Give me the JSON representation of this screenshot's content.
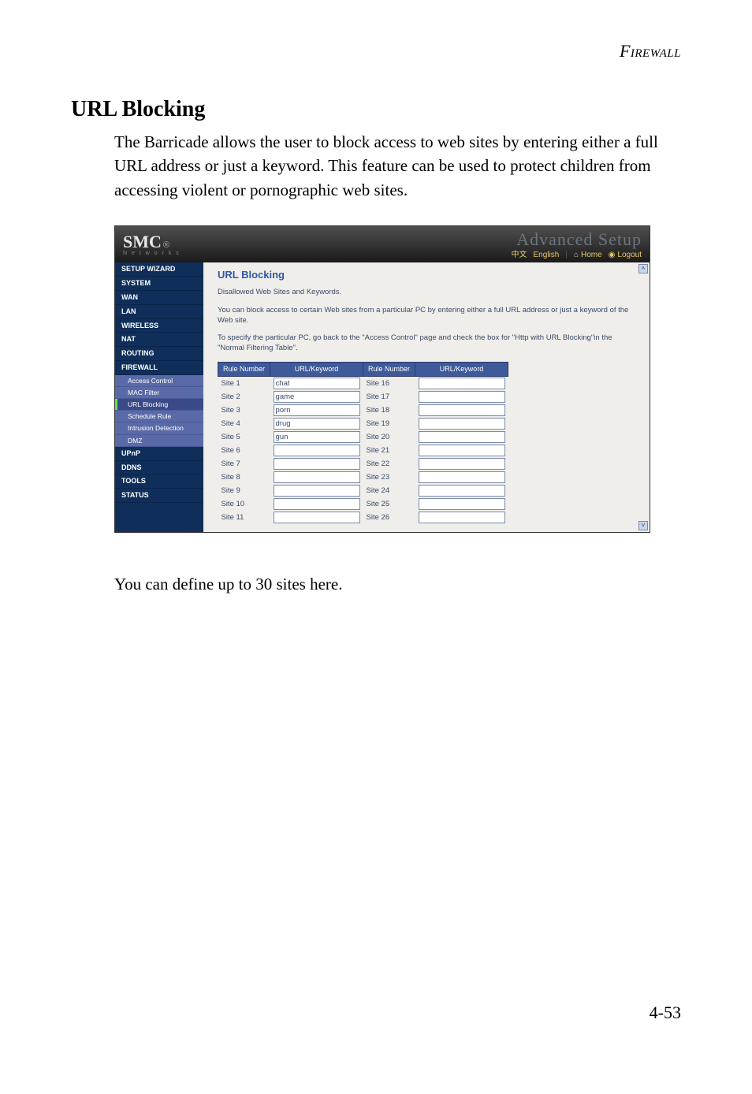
{
  "doc": {
    "running_head": "Firewall",
    "section_title": "URL Blocking",
    "intro": "The Barricade allows the user to block access to web sites by entering either a full URL address or just a keyword. This feature can be used to protect children from accessing violent or pornographic web sites.",
    "after_text": "You can define up to 30 sites here.",
    "page_num": "4-53"
  },
  "router": {
    "brand_main": "SMC",
    "brand_reg": "®",
    "brand_sub": "N e t w o r k s",
    "adv_setup": "Advanced Setup",
    "lang_cn": "中文",
    "lang_en": "English",
    "home": "Home",
    "logout": "Logout",
    "sidebar": {
      "items": [
        {
          "label": "SETUP WIZARD",
          "type": "top"
        },
        {
          "label": "SYSTEM",
          "type": "top"
        },
        {
          "label": "WAN",
          "type": "top"
        },
        {
          "label": "LAN",
          "type": "top"
        },
        {
          "label": "WIRELESS",
          "type": "top"
        },
        {
          "label": "NAT",
          "type": "top"
        },
        {
          "label": "ROUTING",
          "type": "top"
        },
        {
          "label": "FIREWALL",
          "type": "top"
        },
        {
          "label": "Access Control",
          "type": "sub"
        },
        {
          "label": "MAC Filter",
          "type": "sub"
        },
        {
          "label": "URL Blocking",
          "type": "sub",
          "active": true
        },
        {
          "label": "Schedule Rule",
          "type": "sub"
        },
        {
          "label": "Intrusion Detection",
          "type": "sub"
        },
        {
          "label": "DMZ",
          "type": "sub"
        },
        {
          "label": "UPnP",
          "type": "top"
        },
        {
          "label": "DDNS",
          "type": "top"
        },
        {
          "label": "TOOLS",
          "type": "top"
        },
        {
          "label": "STATUS",
          "type": "top"
        }
      ]
    },
    "content": {
      "title": "URL Blocking",
      "p1": "Disallowed Web Sites and Keywords.",
      "p2": "You can block access to certain Web sites from a particular PC by entering either a full URL address or just a keyword of the Web site.",
      "p3": "To specify the particular PC, go back to the \"Access Control\" page and check the box for \"Http with URL Blocking\"in the \"Normal Filtering Table\".",
      "headers": {
        "rule": "Rule Number",
        "url": "URL/Keyword"
      },
      "rows_left": [
        {
          "rn": "Site 1",
          "val": "chat"
        },
        {
          "rn": "Site 2",
          "val": "game"
        },
        {
          "rn": "Site 3",
          "val": "porn"
        },
        {
          "rn": "Site 4",
          "val": "drug"
        },
        {
          "rn": "Site 5",
          "val": "gun"
        },
        {
          "rn": "Site 6",
          "val": ""
        },
        {
          "rn": "Site 7",
          "val": ""
        },
        {
          "rn": "Site 8",
          "val": ""
        },
        {
          "rn": "Site 9",
          "val": ""
        },
        {
          "rn": "Site 10",
          "val": ""
        },
        {
          "rn": "Site 11",
          "val": ""
        }
      ],
      "rows_right": [
        {
          "rn": "Site 16",
          "val": ""
        },
        {
          "rn": "Site 17",
          "val": ""
        },
        {
          "rn": "Site 18",
          "val": ""
        },
        {
          "rn": "Site 19",
          "val": ""
        },
        {
          "rn": "Site 20",
          "val": ""
        },
        {
          "rn": "Site 21",
          "val": ""
        },
        {
          "rn": "Site 22",
          "val": ""
        },
        {
          "rn": "Site 23",
          "val": ""
        },
        {
          "rn": "Site 24",
          "val": ""
        },
        {
          "rn": "Site 25",
          "val": ""
        },
        {
          "rn": "Site 26",
          "val": ""
        }
      ]
    }
  }
}
